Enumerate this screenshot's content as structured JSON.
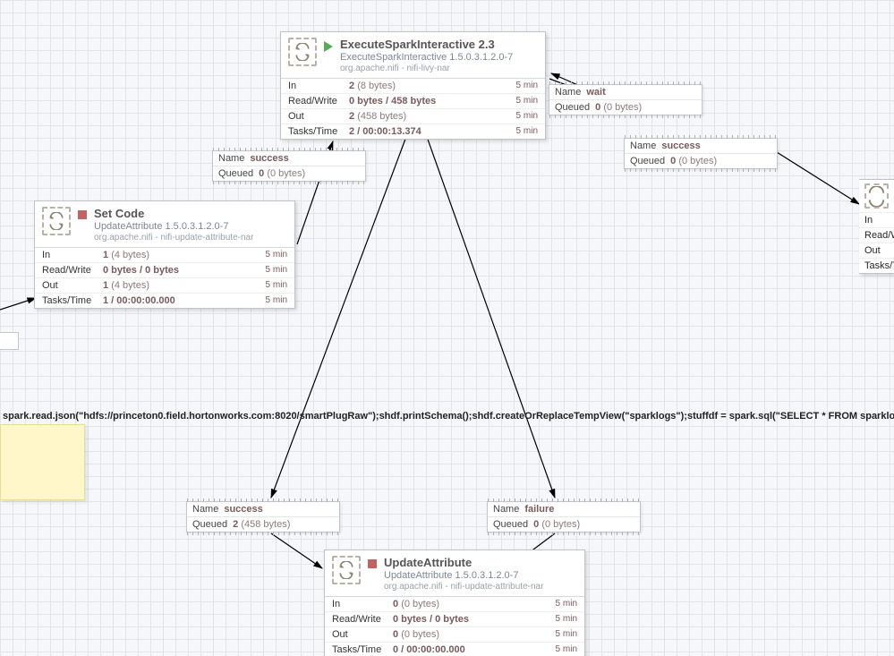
{
  "labels": {
    "in": "In",
    "rw": "Read/Write",
    "out": "Out",
    "tt": "Tasks/Time",
    "window": "5 min",
    "name": "Name",
    "queued": "Queued"
  },
  "cutoff": {
    "rw": "Read/W",
    "tt": "Tasks/T"
  },
  "processors": [
    {
      "title": "ExecuteSparkInteractive 2.3",
      "subtitle": "ExecuteSparkInteractive 1.5.0.3.1.2.0-7",
      "bundle": "org.apache.nifi - nifi-livy-nar",
      "in": {
        "n": "2",
        "b": "(8 bytes)"
      },
      "rw": "0 bytes / 458 bytes",
      "out": {
        "n": "2",
        "b": "(458 bytes)"
      },
      "tt": "2 / 00:00:13.374"
    },
    {
      "title": "Set Code",
      "subtitle": "UpdateAttribute 1.5.0.3.1.2.0-7",
      "bundle": "org.apache.nifi - nifi-update-attribute-nar",
      "in": {
        "n": "1",
        "b": "(4 bytes)"
      },
      "rw": "0 bytes / 0 bytes",
      "out": {
        "n": "1",
        "b": "(4 bytes)"
      },
      "tt": "1 / 00:00:00.000"
    },
    {
      "title": "UpdateAttribute",
      "subtitle": "UpdateAttribute 1.5.0.3.1.2.0-7",
      "bundle": "org.apache.nifi - nifi-update-attribute-nar",
      "in": {
        "n": "0",
        "b": "(0 bytes)"
      },
      "rw": "0 bytes / 0 bytes",
      "out": {
        "n": "0",
        "b": "(0 bytes)"
      },
      "tt": "0 / 00:00:00.000"
    }
  ],
  "connections": [
    {
      "name": "success",
      "q": {
        "n": "0",
        "b": "(0 bytes)"
      }
    },
    {
      "name": "wait",
      "q": {
        "n": "0",
        "b": "(0 bytes)"
      }
    },
    {
      "name": "success",
      "q": {
        "n": "0",
        "b": "(0 bytes)"
      }
    },
    {
      "name": "success",
      "q": {
        "n": "2",
        "b": "(458 bytes)"
      }
    },
    {
      "name": "failure",
      "q": {
        "n": "0",
        "b": "(0 bytes)"
      }
    }
  ],
  "code": "spark.read.json(\"hdfs://princeton0.field.hortonworks.com:8020/smartPlugRaw\");shdf.printSchema();shdf.createOrReplaceTempView(\"sparklogs\");stuffdf = spark.sql(\"SELECT * FROM sparklogs\");stuffdf.count();"
}
